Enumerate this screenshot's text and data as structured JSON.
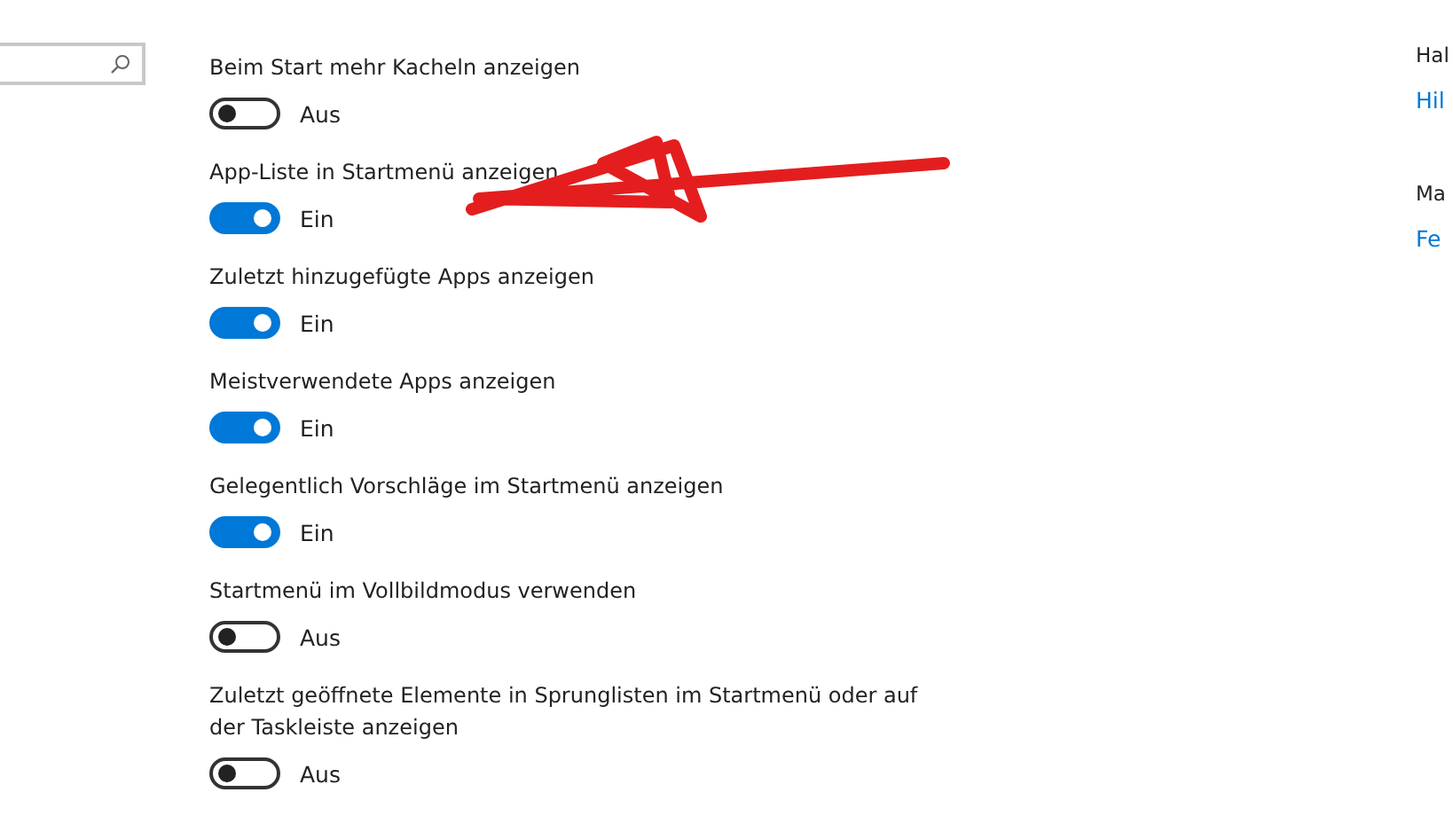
{
  "sidebar": {
    "search": {
      "kind": "search"
    }
  },
  "page": {
    "settings": [
      {
        "label": "Beim Start mehr Kacheln anzeigen",
        "on": false,
        "state_text": "Aus"
      },
      {
        "label": "App-Liste in Startmenü anzeigen",
        "on": true,
        "state_text": "Ein"
      },
      {
        "label": "Zuletzt hinzugefügte Apps anzeigen",
        "on": true,
        "state_text": "Ein"
      },
      {
        "label": "Meistverwendete Apps anzeigen",
        "on": true,
        "state_text": "Ein"
      },
      {
        "label": "Gelegentlich Vorschläge im Startmenü anzeigen",
        "on": true,
        "state_text": "Ein"
      },
      {
        "label": "Startmenü im Vollbildmodus verwenden",
        "on": false,
        "state_text": "Aus"
      },
      {
        "label": "Zuletzt geöffnete Elemente in Sprunglisten im Startmenü oder auf der Taskleiste anzeigen",
        "on": false,
        "state_text": "Aus"
      }
    ]
  },
  "aside": {
    "sections": [
      {
        "heading": "Hal",
        "link": "Hil"
      },
      {
        "heading": "Ma",
        "link": "Fe"
      }
    ]
  }
}
